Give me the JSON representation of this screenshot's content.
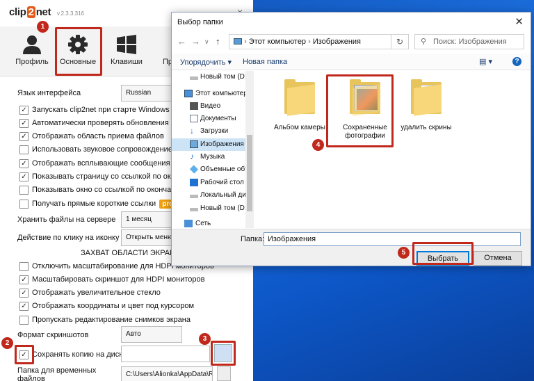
{
  "clip2net": {
    "logo": "clip2net",
    "version": "v.2.3.3.316",
    "close": "×",
    "toolbar": [
      {
        "label": "Профиль",
        "icon": "user-icon"
      },
      {
        "label": "Основные",
        "icon": "gear-icon"
      },
      {
        "label": "Клавиши",
        "icon": "windows-keys-icon"
      },
      {
        "label": "Пр",
        "icon": "proxy-icon"
      }
    ],
    "language_label": "Язык интерфейса",
    "language_value": "Russian",
    "checkboxes": [
      {
        "label": "Запускать clip2net при старте Windows",
        "checked": true
      },
      {
        "label": "Автоматически проверять обновления",
        "checked": true
      },
      {
        "label": "Отображать область приема файлов",
        "checked": true
      },
      {
        "label": "Использовать звуковое сопровождение",
        "checked": false
      },
      {
        "label": "Отображать всплывающие сообщения",
        "checked": true
      },
      {
        "label": "Показывать страницу со ссылкой по оконч",
        "checked": true
      },
      {
        "label": "Показывать окно со ссылкой по окончани",
        "checked": false
      },
      {
        "label": "Получать прямые короткие ссылки",
        "checked": false
      }
    ],
    "pro_badge": "pro",
    "store_label": "Хранить файлы на сервере",
    "store_value": "1 месяц",
    "click_label": "Действие по клику на иконку",
    "click_value": "Открыть меню",
    "section_title": "ЗАХВАТ ОБЛАСТИ ЭКРАНА",
    "capture_checkboxes": [
      {
        "label": "Отключить масштабирование для HDPI мониторов",
        "checked": false
      },
      {
        "label": "Масштабировать скриншот для HDPI мониторов",
        "checked": true
      },
      {
        "label": "Отображать увеличительное стекло",
        "checked": true
      },
      {
        "label": "Отображать координаты и цвет под курсором",
        "checked": true
      },
      {
        "label": "Пропускать редактирование снимков экрана",
        "checked": false
      }
    ],
    "format_label": "Формат скриншотов",
    "format_value": "Авто",
    "save_copy_label": "Сохранять копию на диск",
    "save_copy_checked": true,
    "temp_label_1": "Папка для временных",
    "temp_label_2": "файлов",
    "temp_path": "C:\\Users\\Alionka\\AppData\\R"
  },
  "dialog": {
    "title": "Выбор папки",
    "close": "✕",
    "address": [
      "Этот компьютер",
      "Изображения"
    ],
    "search_placeholder": "Поиск: Изображения",
    "organize": "Упорядочить ▾",
    "new_folder": "Новая папка",
    "help": "?",
    "nav": [
      {
        "label": "Новый том (D:)",
        "icon": "drive-icon"
      },
      {
        "label": "Этот компьютер",
        "icon": "computer-icon"
      },
      {
        "label": "Видео",
        "icon": "video-icon"
      },
      {
        "label": "Документы",
        "icon": "documents-icon"
      },
      {
        "label": "Загрузки",
        "icon": "downloads-icon"
      },
      {
        "label": "Изображения",
        "icon": "pictures-icon"
      },
      {
        "label": "Музыка",
        "icon": "music-icon"
      },
      {
        "label": "Объемные объ",
        "icon": "3d-objects-icon"
      },
      {
        "label": "Рабочий стол",
        "icon": "desktop-icon"
      },
      {
        "label": "Локальный дис",
        "icon": "drive-icon"
      },
      {
        "label": "Новый том (D:)",
        "icon": "drive-icon"
      },
      {
        "label": "Сеть",
        "icon": "network-icon"
      }
    ],
    "files": [
      {
        "line1": "Альбом камеры",
        "line2": ""
      },
      {
        "line1": "Сохраненные",
        "line2": "фотографии"
      },
      {
        "line1": "удалить скрины",
        "line2": ""
      }
    ],
    "folder_label": "Папка:",
    "folder_value": "Изображения",
    "select_button": "Выбрать",
    "cancel_button": "Отмена"
  },
  "badges": [
    "1",
    "2",
    "3",
    "4",
    "5"
  ],
  "colors": {
    "annotation": "#c0281c",
    "desktop": "#1c6fe0",
    "selection": "#cde4f7",
    "pro": "#f0a010"
  }
}
